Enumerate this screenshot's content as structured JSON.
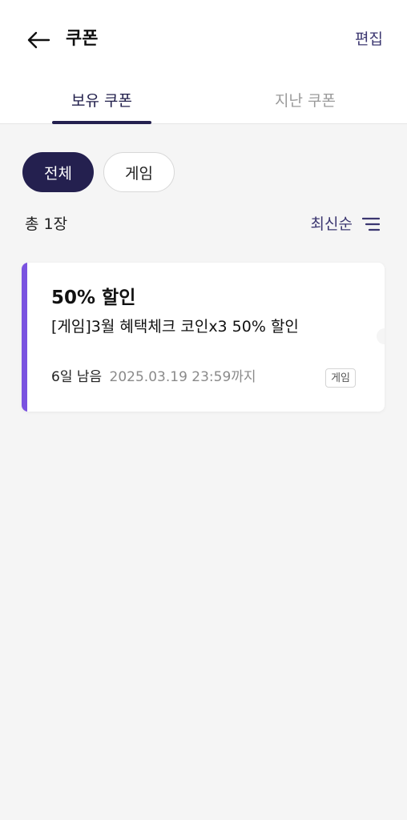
{
  "header": {
    "back_icon": "arrow-left-icon",
    "title": "쿠폰",
    "edit_label": "편집"
  },
  "tabs": [
    {
      "label": "보유 쿠폰",
      "active": true
    },
    {
      "label": "지난 쿠폰",
      "active": false
    }
  ],
  "filters": [
    {
      "label": "전체",
      "selected": true
    },
    {
      "label": "게임",
      "selected": false
    }
  ],
  "summary": {
    "count_label": "총 1장",
    "sort_label": "최신순",
    "sort_icon": "sort-lines-icon"
  },
  "coupons": [
    {
      "title": "50% 할인",
      "description": "[게임]3월 혜택체크 코인x3 50% 할인",
      "remaining": "6일 남음",
      "expiry": "2025.03.19 23:59까지",
      "tag": "게임"
    }
  ],
  "colors": {
    "accent": "#7a52e0",
    "primary_dark": "#24204f",
    "link": "#3b3670",
    "background": "#f5f5f5"
  }
}
